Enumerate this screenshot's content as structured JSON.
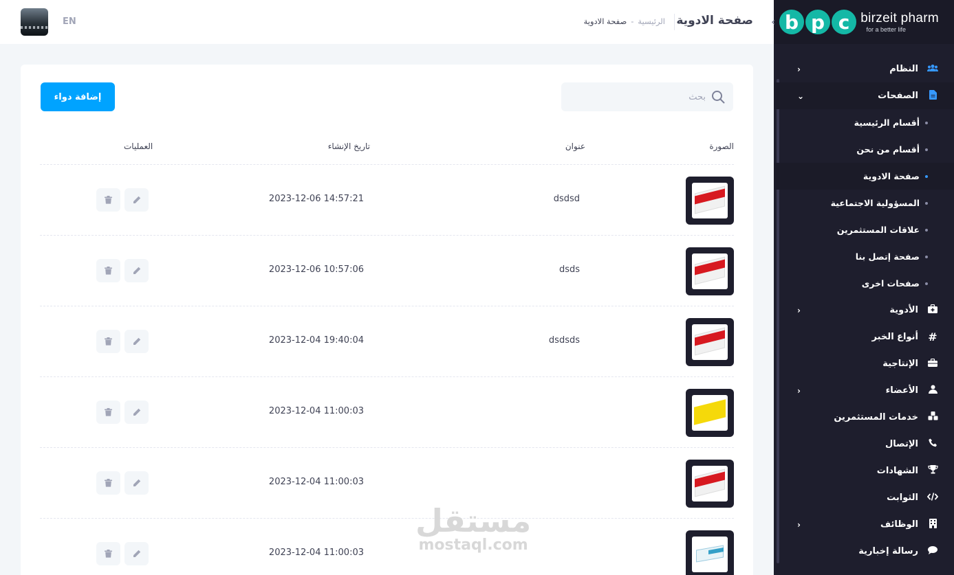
{
  "header": {
    "lang": "EN",
    "page_title": "صفحة الادوية",
    "breadcrumb": {
      "home": "الرئيسية",
      "sep": "-",
      "current": "صفحة الادوية"
    }
  },
  "brand": {
    "letters": [
      "b",
      "p",
      "c"
    ],
    "name": "birzeit pharm",
    "tagline": "for a better life"
  },
  "sidebar": {
    "items": [
      {
        "label": "النظام",
        "icon": "users-icon",
        "chevron": true
      },
      {
        "label": "الصفحات",
        "icon": "file-icon",
        "chevron": true,
        "open": true,
        "children": [
          {
            "label": "أقسام الرئيسية"
          },
          {
            "label": "أقسام من نحن"
          },
          {
            "label": "صفحة الادوية",
            "active": true
          },
          {
            "label": "المسؤولية الاجتماعية"
          },
          {
            "label": "علاقات المستثمرين"
          },
          {
            "label": "صفحة إتصل بنا"
          },
          {
            "label": "صفحات اخرى"
          }
        ]
      },
      {
        "label": "الأدوية",
        "icon": "medkit-icon",
        "chevron": true
      },
      {
        "label": "أنواع الخبر",
        "icon": "hashtag-icon",
        "chevron": false
      },
      {
        "label": "الإنتاجية",
        "icon": "briefcase-icon",
        "chevron": false
      },
      {
        "label": "الأعضاء",
        "icon": "user-icon",
        "chevron": true
      },
      {
        "label": "خدمات المستثمرين",
        "icon": "cubes-icon",
        "chevron": false
      },
      {
        "label": "الإتصال",
        "icon": "phone-icon",
        "chevron": false
      },
      {
        "label": "الشهادات",
        "icon": "trophy-icon",
        "chevron": false
      },
      {
        "label": "الثوابت",
        "icon": "code-icon",
        "chevron": false
      },
      {
        "label": "الوظائف",
        "icon": "building-icon",
        "chevron": true
      },
      {
        "label": "رسالة إخبارية",
        "icon": "comment-icon",
        "chevron": false
      }
    ]
  },
  "toolbar": {
    "search_placeholder": "بحث",
    "add_label": "إضافة دواء"
  },
  "table": {
    "headers": {
      "image": "الصورة",
      "title": "عنوان",
      "date": "تاريخ الإنشاء",
      "ops": "العمليات"
    },
    "rows": [
      {
        "image": "red-pack",
        "title": "dsdsd",
        "date": "2023-12-06 14:57:21"
      },
      {
        "image": "red-pack",
        "title": "dsds",
        "date": "2023-12-06 10:57:06"
      },
      {
        "image": "red-pack",
        "title": "dsdsds",
        "date": "2023-12-04 19:40:04"
      },
      {
        "image": "yellow-pack",
        "title": "",
        "date": "2023-12-04 11:00:03"
      },
      {
        "image": "red-pack",
        "title": "",
        "date": "2023-12-04 11:00:03"
      },
      {
        "image": "teal-pack",
        "title": "",
        "date": "2023-12-04 11:00:03"
      }
    ]
  },
  "watermark": {
    "arabic": "مستقل",
    "latin": "mostaql.com"
  }
}
